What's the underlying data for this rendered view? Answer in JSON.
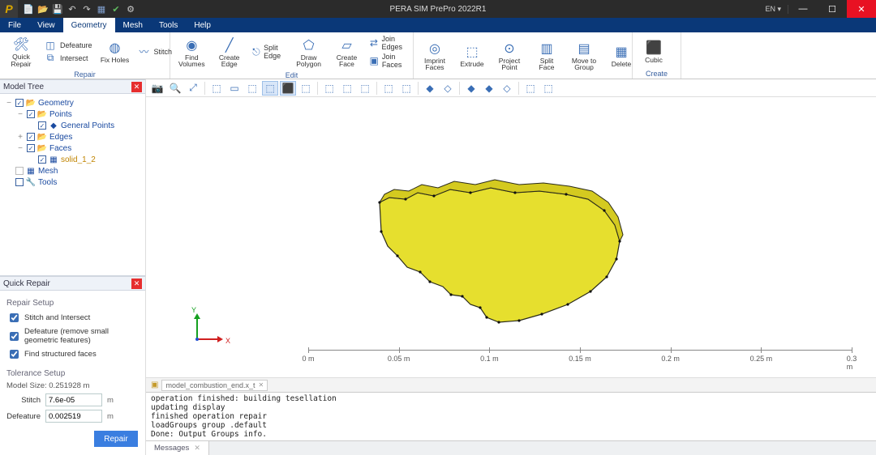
{
  "app": {
    "title": "PERA SIM PrePro 2022R1",
    "logo": "P",
    "lang": "EN ▾"
  },
  "qat": [
    "new",
    "open",
    "save",
    "undo",
    "redo",
    "mesh",
    "check",
    "settings"
  ],
  "menu": {
    "items": [
      "File",
      "View",
      "Geometry",
      "Mesh",
      "Tools",
      "Help"
    ],
    "active": 2
  },
  "ribbon": {
    "groups": [
      {
        "name": "Repair",
        "big": {
          "label": "Quick Repair"
        },
        "col": [
          {
            "label": "Defeature"
          },
          {
            "label": "Intersect"
          }
        ],
        "col2": {
          "big": {
            "label": "Fix Holes"
          },
          "side": {
            "label": "Stitch"
          }
        }
      },
      {
        "name": "",
        "items": [
          {
            "label": "Find Volumes"
          },
          {
            "label": "Create Edge"
          },
          {
            "label": "Draw Polygon"
          }
        ],
        "col": [
          {
            "label": "Split Edge"
          }
        ]
      },
      {
        "name": "Edit",
        "items": [
          {
            "label": "Create Face"
          }
        ],
        "col": [
          {
            "label": "Join Edges"
          },
          {
            "label": "Join Faces"
          }
        ],
        "items2": [
          {
            "label": "Imprint\nFaces"
          },
          {
            "label": "Extrude"
          },
          {
            "label": "Project\nPoint"
          },
          {
            "label": "Split Face"
          },
          {
            "label": "Move to\nGroup"
          },
          {
            "label": "Delete"
          }
        ]
      },
      {
        "name": "Create",
        "items": [
          {
            "label": "Cubic"
          }
        ]
      }
    ]
  },
  "tree": {
    "title": "Model Tree",
    "nodes": [
      {
        "d": 0,
        "tw": "−",
        "chk": "on",
        "ico": "📂",
        "label": "Geometry"
      },
      {
        "d": 1,
        "tw": "−",
        "chk": "on",
        "ico": "📂",
        "label": "Points"
      },
      {
        "d": 2,
        "tw": " ",
        "chk": "on",
        "ico": "◆",
        "label": "General Points"
      },
      {
        "d": 1,
        "tw": "+",
        "chk": "on",
        "ico": "📂",
        "label": "Edges"
      },
      {
        "d": 1,
        "tw": "−",
        "chk": "on",
        "ico": "📂",
        "label": "Faces"
      },
      {
        "d": 2,
        "tw": " ",
        "chk": "on",
        "ico": "▦",
        "label": "solid_1_2",
        "sel": true
      },
      {
        "d": 0,
        "tw": " ",
        "chk": "empty",
        "ico": "▦",
        "label": "Mesh"
      },
      {
        "d": 0,
        "tw": " ",
        "chk": "",
        "ico": "🔧",
        "label": "Tools"
      }
    ]
  },
  "qr": {
    "title": "Quick Repair",
    "setup_label": "Repair Setup",
    "opts": [
      {
        "label": "Stitch and Intersect",
        "on": true
      },
      {
        "label": "Defeature (remove small geometric features)",
        "on": true
      },
      {
        "label": "Find structured faces",
        "on": true
      }
    ],
    "tol_label": "Tolerance Setup",
    "model_size": "Model Size: 0.251928 m",
    "fields": [
      {
        "label": "Stitch",
        "value": "7.6e-05",
        "unit": "m"
      },
      {
        "label": "Defeature",
        "value": "0.002519",
        "unit": "m"
      }
    ],
    "button": "Repair"
  },
  "viewbar_active": [
    6,
    7,
    21,
    22
  ],
  "ruler": {
    "ticks": [
      "0 m",
      "0.05 m",
      "0.1 m",
      "0.15 m",
      "0.2 m",
      "0.25 m",
      "0.3 m"
    ]
  },
  "axis": {
    "x": "X",
    "y": "Y"
  },
  "tabs": [
    {
      "label": "model_combustion_end.x_t"
    }
  ],
  "console": "operation finished: building tesellation\nupdating display\nfinished operation repair\nloadGroups group .default\nDone: Output Groups info.",
  "status": {
    "tab": "Messages"
  }
}
